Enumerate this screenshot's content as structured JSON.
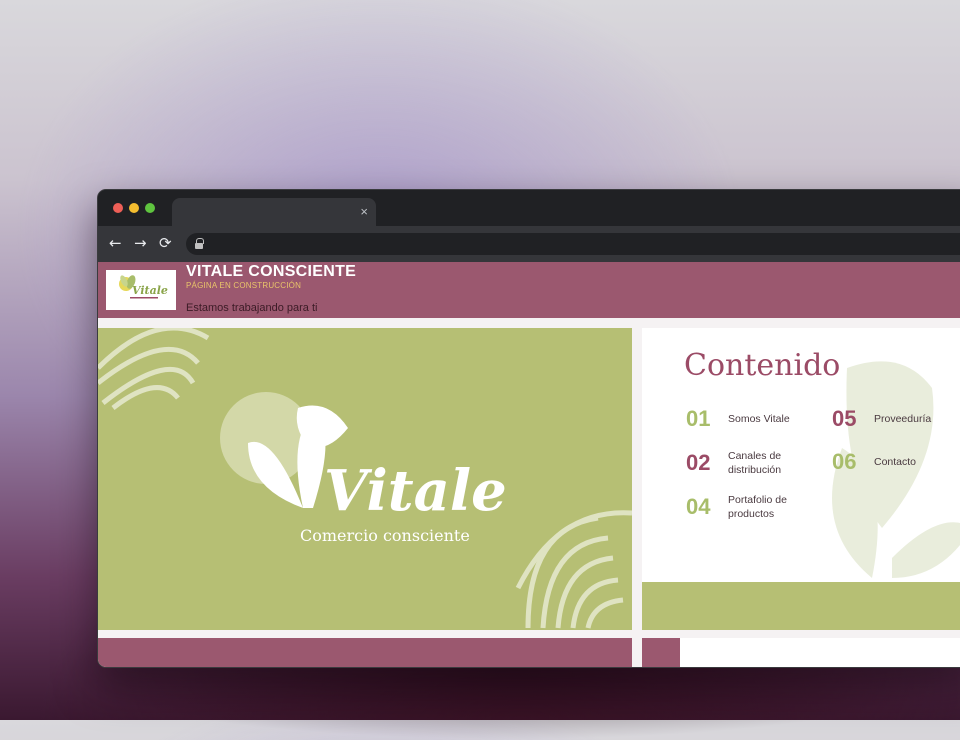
{
  "browser": {
    "tab": {
      "close_glyph": "×"
    },
    "nav": {
      "back_icon": "←",
      "forward_icon": "→",
      "reload_icon": "⟳"
    }
  },
  "site": {
    "title": "VITALE CONSCIENTE",
    "subtitle": "PÁGINA EN CONSTRUCCIÓN",
    "message": "Estamos trabajando para ti"
  },
  "hero": {
    "brand": "Vitale",
    "tagline": "Comercio consciente"
  },
  "content": {
    "title": "Contenido",
    "items": [
      {
        "num": "01",
        "label_line1": "Somos Vitale",
        "label_line2": ""
      },
      {
        "num": "02",
        "label_line1": "Canales de",
        "label_line2": "distribución"
      },
      {
        "num": "04",
        "label_line1": "Portafolio de",
        "label_line2": "productos"
      },
      {
        "num": "05",
        "label_line1": "Proveeduría",
        "label_line2": ""
      },
      {
        "num": "06",
        "label_line1": "Contacto",
        "label_line2": ""
      }
    ]
  },
  "colors": {
    "header_bg": "#9b586f",
    "hero_green": "#b6bf74",
    "accent_plum": "#9b4b66",
    "accent_green": "#a8bd6a",
    "subtitle_gold": "#e9c56a"
  }
}
